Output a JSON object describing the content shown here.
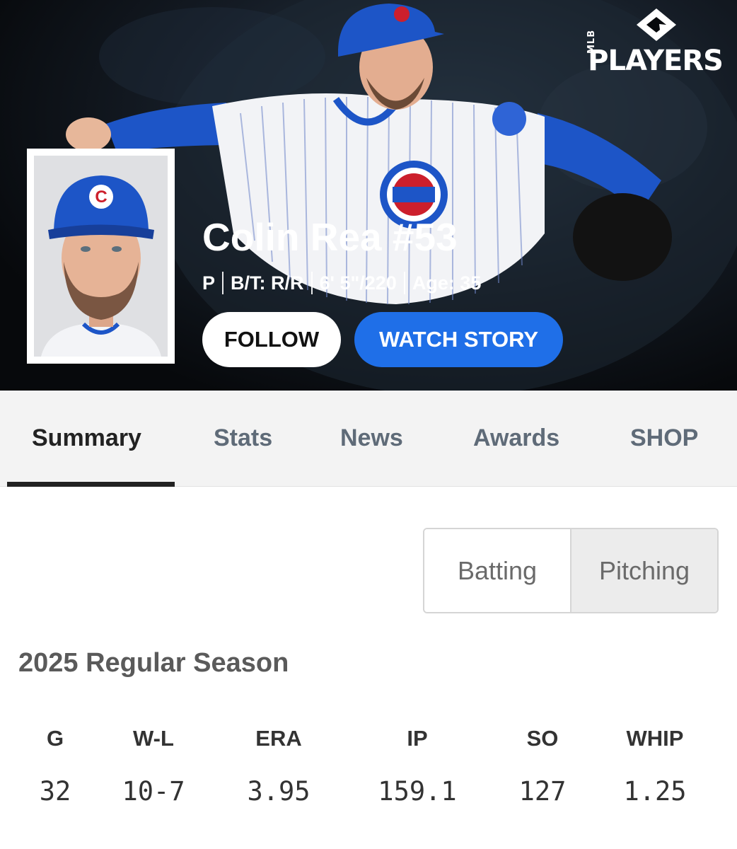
{
  "brand": {
    "logo_text": "PLAYERS",
    "logo_sub": "MLB"
  },
  "player": {
    "name": "Colin Rea #53",
    "position": "P",
    "bats_throws": "B/T: R/R",
    "height_weight": "6' 5\"/220",
    "age": "Age: 35",
    "team_mark": "C"
  },
  "actions": {
    "follow_label": "FOLLOW",
    "watch_label": "WATCH STORY"
  },
  "tabs": [
    {
      "label": "Summary",
      "active": true
    },
    {
      "label": "Stats",
      "active": false
    },
    {
      "label": "News",
      "active": false
    },
    {
      "label": "Awards",
      "active": false
    },
    {
      "label": "SHOP",
      "active": false
    }
  ],
  "stat_toggle": {
    "options": [
      "Batting",
      "Pitching"
    ],
    "selected": "Pitching"
  },
  "season": {
    "title": "2025 Regular Season",
    "stats": [
      {
        "label": "G",
        "value": "32"
      },
      {
        "label": "W-L",
        "value": "10-7"
      },
      {
        "label": "ERA",
        "value": "3.95"
      },
      {
        "label": "IP",
        "value": "159.1"
      },
      {
        "label": "SO",
        "value": "127"
      },
      {
        "label": "WHIP",
        "value": "1.25"
      }
    ]
  },
  "colors": {
    "accent_blue": "#1f6fe8",
    "cubs_blue": "#1f4fbf",
    "cubs_red": "#cc1f2c",
    "hero_bg": "#07090c"
  }
}
